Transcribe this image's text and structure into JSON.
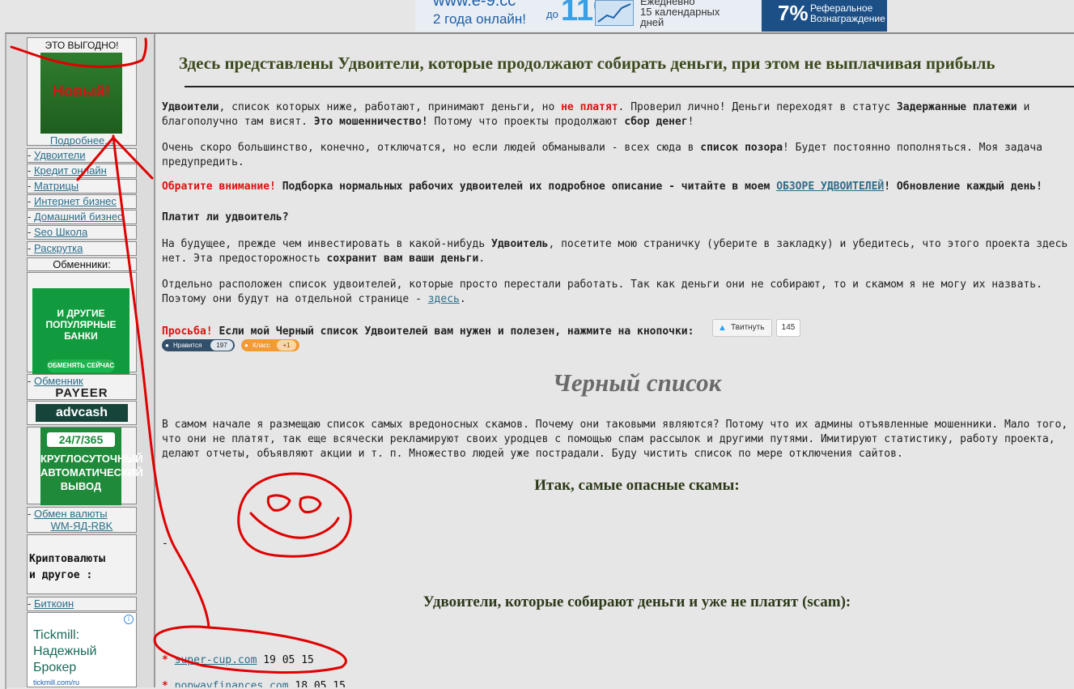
{
  "banner": {
    "url": "www.e-9.cc",
    "online": "2 года онлайн!",
    "upto": "до",
    "percent": "11%",
    "daily": [
      "Ежедневно",
      "15 календарных",
      "дней"
    ],
    "ref_percent": "7%",
    "ref_text": [
      "Реферальное",
      "Вознаграждение"
    ]
  },
  "sidebar": {
    "promo_title": "ЭТО ВЫГОДНО!",
    "promo_new": "Новый!",
    "promo_more": "Подробнее...",
    "menu": [
      "Удвоители",
      "Кредит онлайн",
      "Матрицы",
      "Интернет бизнес",
      "Домашний бизнес",
      "Seo Школа",
      "Раскрутка"
    ],
    "dash": "-",
    "exchangers_heading": "Обменники:",
    "exchange_banner": [
      "И ДРУГИЕ",
      "ПОПУЛЯРНЫЕ",
      "БАНКИ"
    ],
    "exchange_banner_button": "ОБМЕНЯТЬ СЕЙЧАС",
    "payeer_link": "Обменник",
    "payeer_logo": "PAYEER",
    "advcash_logo": "advcash",
    "auto_247": "24/7/365",
    "auto_text": [
      "КРУГЛОСУТОЧНЫЙ",
      "АВТОМАТИЧЕСКИЙ",
      "ВЫВОД"
    ],
    "currency_exchange": "Обмен валюты",
    "currency_pairs": "WM-ЯД-RBK",
    "crypto_heading": [
      "Криптовалюты",
      "и другое :"
    ],
    "bitcoin": "Биткоин",
    "ad_text": [
      "Tickmill:",
      "Надежный",
      "Брокер"
    ],
    "ad_url": "tickmill.com/ru",
    "ad_info": "i"
  },
  "main": {
    "title": "Здесь представлены Удвоители, которые продолжают собирать деньги, при этом не выплачивая прибыль",
    "p1": {
      "a": "Удвоители",
      "b": ", список которых ниже, работают, принимают деньги, но ",
      "c": "не платят",
      "d": ". Проверил лично! Деньги переходят в статус ",
      "e": "Задержанные платежи",
      "f": " и благополучно там висят. ",
      "g": "Это мошенничество!",
      "h": " Потому что проекты продолжают ",
      "i": "сбор денег",
      "j": "!"
    },
    "p2": {
      "a": "Очень скоро большинство, конечно, отключатся, но если людей обманывали - всех сюда в ",
      "b": "список позора",
      "c": "! Будет постоянно пополняться. Моя задача предупредить."
    },
    "p3": {
      "a": "Обратите внимание!",
      "b": " Подборка нормальных рабочих удвоителей их подробное описание - читайте в моем ",
      "c": "ОБЗОРЕ УДВОИТЕЛЕЙ",
      "d": "! Обновление каждый день!"
    },
    "question": "Платит ли удвоитель?",
    "p4": {
      "a": "На будущее, прежде чем инвестировать в какой-нибудь ",
      "b": "Удвоитель",
      "c": ", посетите мою страничку (уберите в закладку) и убедитесь, что этого проекта здесь нет. Эта предосторожность ",
      "d": "сохранит вам ваши деньги",
      "e": "."
    },
    "p5": {
      "a": "Отдельно расположен список удвоителей, которые просто перестали работать. Так как деньги они не собирают, то и скамом я не могу их назвать. Поэтому они будут на отдельной странице - ",
      "b": "здесь",
      "c": "."
    },
    "request": {
      "a": "Просьба!",
      "b": " Если мой Черный список Удвоителей вам нужен и полезен, нажмите на кнопочки:"
    },
    "tweet_label": "Твитнуть",
    "tweet_count": "145",
    "like_label": "Нравится",
    "like_count": "197",
    "ok_label": "Класс",
    "ok_count": "+1",
    "blacklist_title": "Черный список",
    "blacklist_text": "В самом начале я размещаю список самых вредоносных скамов. Почему они таковыми являются? Потому что их админы отъявленные мошенники. Мало того, что они не платят, так еще всячески рекламируют своих уродцев с помощью спам рассылок и другими путями. Имитируют статистику, работу проекта, делают отчеты, объявляют акции и т. п. Множество людей уже пострадали. Буду чистить список по мере отключения сайтов.",
    "dangerous_heading": "Итак, самые опасные скамы:",
    "dash": "-",
    "scam_heading": "Удвоители, которые собирают деньги и уже не платят (scam):",
    "scams": [
      {
        "star": "*",
        "name": "super-cup.com",
        "date": "19 05 15"
      },
      {
        "star": "*",
        "name": "popwayfinances.com",
        "date": "18 05 15"
      }
    ]
  },
  "colors": {
    "accent_red": "#dd1111",
    "link": "#2b6e8a",
    "annotation": "#e00000"
  }
}
